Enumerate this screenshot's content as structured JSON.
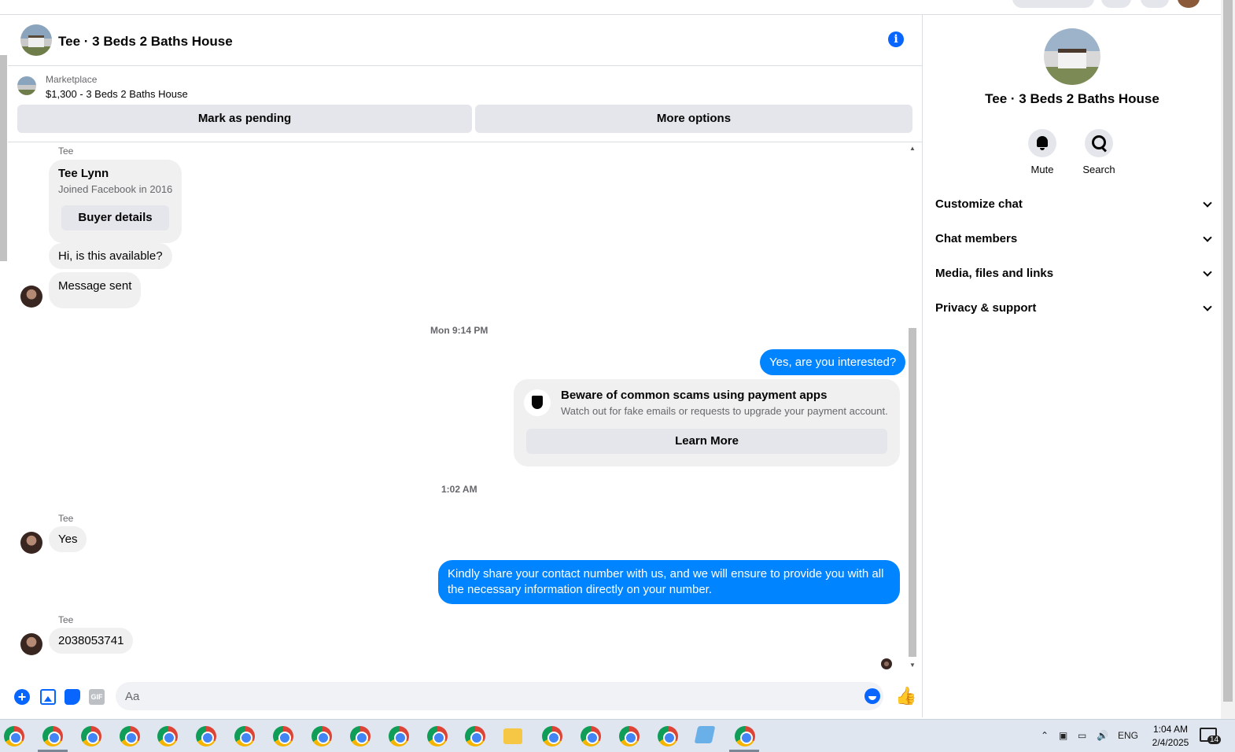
{
  "header": {
    "title": "Tee · 3 Beds 2 Baths House",
    "info_icon": "info-icon"
  },
  "marketplace": {
    "label": "Marketplace",
    "listing": "$1,300 - 3 Beds 2 Baths House",
    "mark_pending_label": "Mark as pending",
    "more_options_label": "More options"
  },
  "messages": {
    "sender_name": "Tee",
    "card": {
      "name": "Tee Lynn",
      "joined": "Joined Facebook in 2016",
      "button": "Buyer details"
    },
    "incoming_1": "Hi, is this available?",
    "incoming_2": "Message sent",
    "timestamp_1": "Mon 9:14 PM",
    "outgoing_1": "Yes, are you interested?",
    "scam_notice": {
      "title": "Beware of common scams using payment apps",
      "subtitle": "Watch out for fake emails or requests to upgrade your payment account.",
      "button": "Learn More"
    },
    "timestamp_2": "1:02 AM",
    "incoming_3": "Yes",
    "outgoing_2": "Kindly share your contact number with us, and we will ensure to provide you with all the necessary information directly on your number.",
    "incoming_4": "2038053741"
  },
  "composer": {
    "placeholder": "Aa",
    "gif_label": "GIF"
  },
  "right_panel": {
    "title": "Tee · 3 Beds 2 Baths House",
    "mute_label": "Mute",
    "search_label": "Search",
    "rows": [
      "Customize chat",
      "Chat members",
      "Media, files and links",
      "Privacy & support"
    ]
  },
  "taskbar": {
    "language": "ENG",
    "time": "1:04 AM",
    "date": "2/4/2025",
    "notification_count": "14"
  },
  "colors": {
    "accent": "#0866ff",
    "bubble_blue": "#0084ff",
    "bubble_grey": "#f0f0f0"
  }
}
